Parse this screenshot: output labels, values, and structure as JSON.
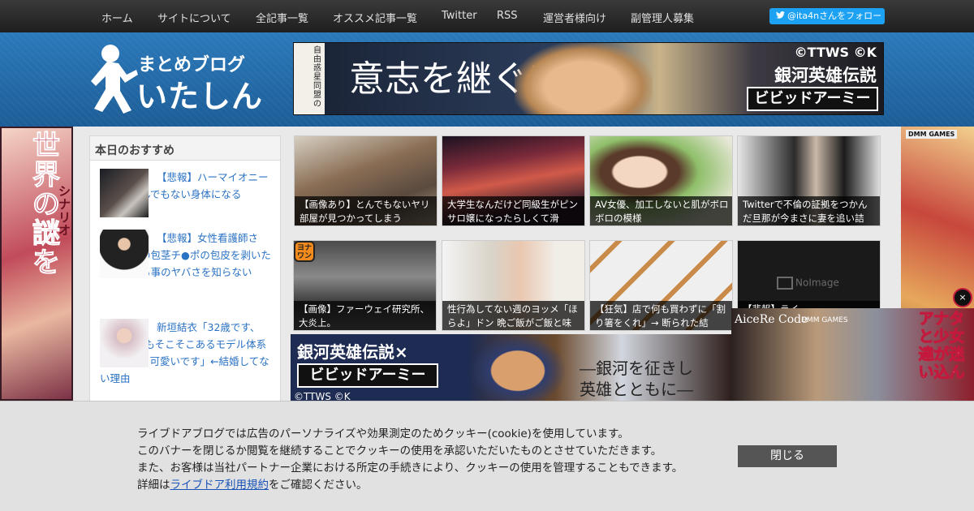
{
  "nav": {
    "items": [
      "ホーム",
      "サイトについて",
      "全記事一覧",
      "オススメ記事一覧",
      "Twitter",
      "RSS",
      "運営者様向け",
      "副管理人募集"
    ],
    "follow_label": "@ita4nさんをフォロー"
  },
  "logo": {
    "top": "まとめブログ",
    "main": "いたしん"
  },
  "banner_top": {
    "vertical_text": "自由惑星同盟の",
    "catch": "意志を継ぐ者",
    "copyright": "©TTWS ©K",
    "title": "銀河英雄伝説",
    "subtitle": "ビビッドアーミー"
  },
  "side_left": {
    "text1": "世界の謎を",
    "text2": "シナリオ"
  },
  "side_right": {
    "brand": "DMM GAMES"
  },
  "recommend": {
    "title": "本日のおすすめ",
    "items": [
      "【悲報】ハーマイオニーさん、とんでもない身体になる",
      "【悲報】女性看護師さん、ガチの包茎チ●ポの包皮を剥いたままにする事のヤバさを知らない",
      "新垣結衣「32歳です、169cm乳もそこそこあるモデル体系です、顔も可愛いです」←結婚してない理由"
    ]
  },
  "grid": [
    "【画像あり】とんでもないヤリ部屋が見つかってしまう",
    "大学生なんだけど同級生がピンサロ嬢になったらしくて滑",
    "AV女優、加工しないと肌がボロボロの模様",
    "Twitterで不倫の証拠をつかんだ旦那が今まさに妻を追い詰",
    "【画像】ファーウェイ研究所、大炎上。",
    "性行為してない週のヨッメ「ほらよ」ドン 晩ご飯がご飯と味",
    "【狂気】店で何も買わずに「割り箸をくれ」→ 断られた結",
    "【悲報】ライ"
  ],
  "badge": "ヨナ ワン",
  "noimage": "NoImage",
  "bottom_ad": {
    "title": "銀河英雄伝説×",
    "subtitle": "ビビッドアーミー",
    "copyright": "©TTWS ©K",
    "catch1": "―銀河を征きし",
    "catch2": "英雄とともに―"
  },
  "ad_right": {
    "logo": "AiceRe Code",
    "brand": "DMM GAMES",
    "catch": "アナタと少女達が迷い込ん",
    "close": "×"
  },
  "cookie": {
    "line1": "ライブドアブログでは広告のパーソナライズや効果測定のためクッキー(cookie)を使用しています。",
    "line2": "このバナーを閉じるか閲覧を継続することでクッキーの使用を承認いただいたものとさせていただきます。",
    "line3": "また、お客様は当社パートナー企業における所定の手続きにより、クッキーの使用を管理することもできます。",
    "line4_pre": "詳細は",
    "line4_link": "ライブドア利用規約",
    "line4_post": "をご確認ください。",
    "close_label": "閉じる"
  },
  "colors": {
    "header": "#2a77b8",
    "link": "#2a72c4",
    "nav_bg": "#2b2b2b",
    "twitter": "#1da1f2"
  }
}
